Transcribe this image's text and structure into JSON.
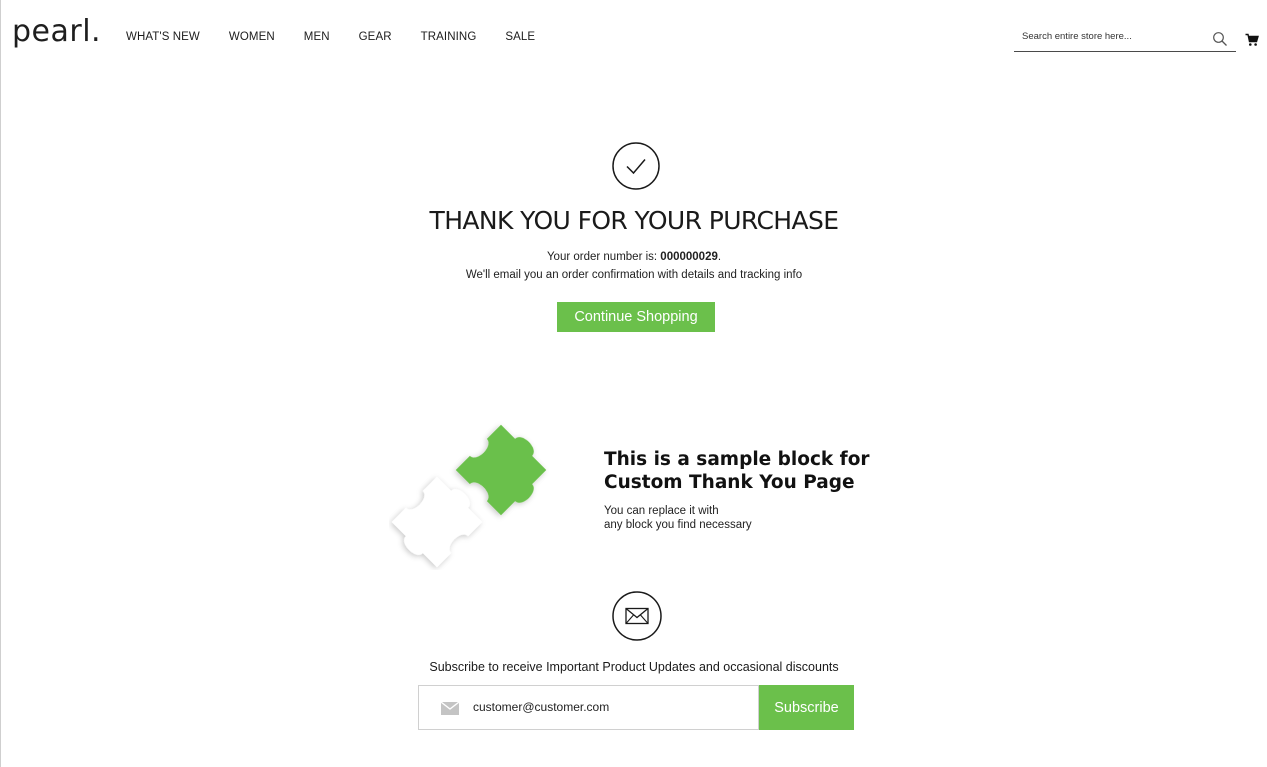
{
  "header": {
    "logo": "pearl.",
    "nav": [
      "WHAT'S NEW",
      "WOMEN",
      "MEN",
      "GEAR",
      "TRAINING",
      "SALE"
    ],
    "search_placeholder": "Search entire store here...",
    "search_icon": "search-icon",
    "cart_icon": "cart-icon"
  },
  "success": {
    "icon": "check-circle-icon",
    "title": "THANK YOU FOR YOUR PURCHASE",
    "order_prefix": "Your order number is: ",
    "order_number": "000000029",
    "order_suffix": ".",
    "email_note": "We'll email you an order confirmation with details and tracking info",
    "continue_label": "Continue Shopping"
  },
  "sample_block": {
    "icon": "puzzle-icon",
    "heading_line1": "This is a sample block for",
    "heading_line2": "Custom Thank You Page",
    "sub_line1": "You can replace it with",
    "sub_line2": "any block you find necessary"
  },
  "subscribe": {
    "icon": "mail-circle-icon",
    "text": "Subscribe to receive Important Product Updates and occasional discounts",
    "email_value": "customer@customer.com",
    "button_label": "Subscribe"
  },
  "colors": {
    "accent": "#6bc04b",
    "text": "#1a1a1a"
  }
}
